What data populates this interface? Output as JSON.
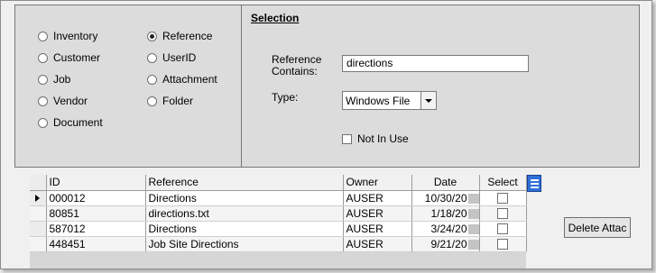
{
  "search_types": {
    "left": [
      {
        "label": "Inventory",
        "checked": false
      },
      {
        "label": "Customer",
        "checked": false
      },
      {
        "label": "Job",
        "checked": false
      },
      {
        "label": "Vendor",
        "checked": false
      },
      {
        "label": "Document",
        "checked": false
      }
    ],
    "right": [
      {
        "label": "Reference",
        "checked": true
      },
      {
        "label": "UserID",
        "checked": false
      },
      {
        "label": "Attachment",
        "checked": false
      },
      {
        "label": "Folder",
        "checked": false
      }
    ]
  },
  "selection": {
    "title": "Selection",
    "reference_label_line1": "Reference",
    "reference_label_line2": "Contains:",
    "reference_value": "directions",
    "type_label": "Type:",
    "type_value": "Windows File",
    "not_in_use_label": "Not In Use",
    "not_in_use_checked": false
  },
  "grid": {
    "columns": [
      "ID",
      "Reference",
      "Owner",
      "Date",
      "Select"
    ],
    "rows": [
      {
        "id": "000012",
        "reference": "Directions",
        "owner": "AUSER",
        "date": "10/30/20",
        "current": true
      },
      {
        "id": "80851",
        "reference": "directions.txt",
        "owner": "AUSER",
        "date": "1/18/20",
        "current": false
      },
      {
        "id": "587012",
        "reference": "Directions",
        "owner": "AUSER",
        "date": "3/24/20",
        "current": false
      },
      {
        "id": "448451",
        "reference": "Job Site Directions",
        "owner": "AUSER",
        "date": "9/21/20",
        "current": false
      }
    ]
  },
  "delete_button_label": "Delete Attac",
  "icons": {
    "column_chooser": "column-chooser-icon",
    "dropdown": "chevron-down-icon",
    "row_indicator": "current-row-icon"
  },
  "colors": {
    "accent": "#2f6fd8"
  }
}
